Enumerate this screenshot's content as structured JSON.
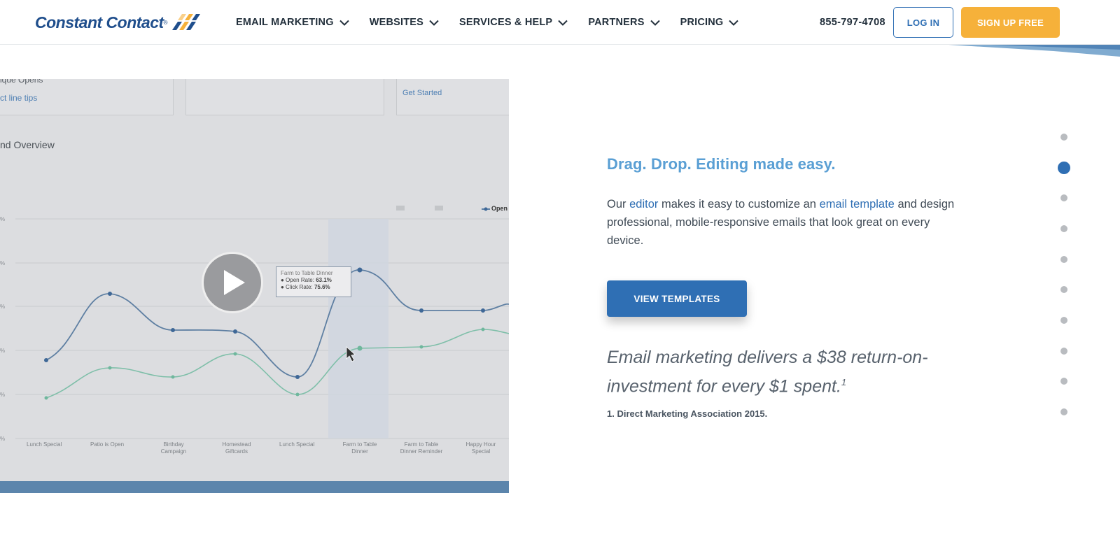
{
  "header": {
    "logo_text": "Constant Contact",
    "logo_mark": "®",
    "nav": [
      {
        "label": "EMAIL MARKETING"
      },
      {
        "label": "WEBSITES"
      },
      {
        "label": "SERVICES & HELP"
      },
      {
        "label": "PARTNERS"
      },
      {
        "label": "PRICING"
      }
    ],
    "phone": "855-797-4708",
    "login_label": "LOG IN",
    "signup_label": "SIGN UP FREE"
  },
  "video": {
    "card_text_1": "ique Opens",
    "card_link_1": "ct line tips",
    "card_link_3": "Get Started",
    "overview_title": "nd Overview",
    "tooltip_title": "Farm to Table Dinner",
    "tooltip_open_label": "● Open Rate:",
    "tooltip_open_value": "63.1%",
    "tooltip_click_label": "● Click Rate:",
    "tooltip_click_value": "75.6%",
    "legend_open": "Open",
    "categories": [
      "Lunch Special",
      "Patio is Open",
      "Birthday Campaign",
      "Homestead Giftcards",
      "Lunch Special",
      "Farm to Table Dinner",
      "Farm to Table Dinner Reminder",
      "Happy Hour Special"
    ]
  },
  "content": {
    "headline": "Drag. Drop. Editing made easy.",
    "body_pre": "Our ",
    "body_link1": "editor",
    "body_mid": " makes it easy to customize an ",
    "body_link2": "email template",
    "body_post": " and design professional, mobile-responsive emails that look great on every device.",
    "button_label": "VIEW TEMPLATES",
    "quote": "Email marketing delivers a $38 return-on-investment for every $1 spent.",
    "quote_sup": "1",
    "footnote": "1. Direct Marketing Association 2015."
  },
  "pager": {
    "count": 10,
    "active_index": 1
  },
  "colors": {
    "brand_blue": "#2f6fb4",
    "headline_blue": "#5a9fd4",
    "signup_orange": "#f6b13a"
  }
}
